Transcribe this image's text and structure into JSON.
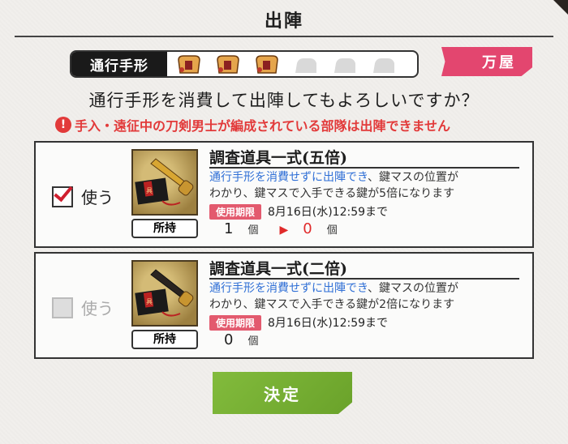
{
  "dialog": {
    "title": "出陣",
    "pass_label": "通行手形",
    "pass_slots": 6,
    "pass_filled": 3,
    "shop_button": "万屋",
    "question": "通行手形を消費して出陣してもよろしいですか？",
    "warning": "手入・遠征中の刀剣男士が編成されている部隊は出陣できません",
    "confirm_button": "決定"
  },
  "items": [
    {
      "use_label": "使う",
      "checked": true,
      "name": "調査道具一式(五倍)",
      "desc_highlight": "通行手形を消費せずに出陣でき",
      "desc_line1_rest": "、鍵マスの位置が",
      "desc_line2": "わかり、鍵マスで入手できる鍵が5倍になります",
      "expiry_badge": "使用期限",
      "expiry_date": "8月16日(水)12:59まで",
      "owned_label": "所持",
      "owned_count": "1",
      "unit": "個",
      "after_count": "0",
      "unit2": "個"
    },
    {
      "use_label": "使う",
      "checked": false,
      "name": "調査道具一式(二倍)",
      "desc_highlight": "通行手形を消費せずに出陣でき",
      "desc_line1_rest": "、鍵マスの位置が",
      "desc_line2": "わかり、鍵マスで入手できる鍵が2倍になります",
      "expiry_badge": "使用期限",
      "expiry_date": "8月16日(水)12:59まで",
      "owned_label": "所持",
      "owned_count": "0",
      "unit": "個"
    }
  ],
  "colors": {
    "accent_red": "#e23a3a",
    "shop_pink": "#e3466f",
    "confirm_green": "#79b034",
    "desc_blue": "#2f6fd6"
  }
}
